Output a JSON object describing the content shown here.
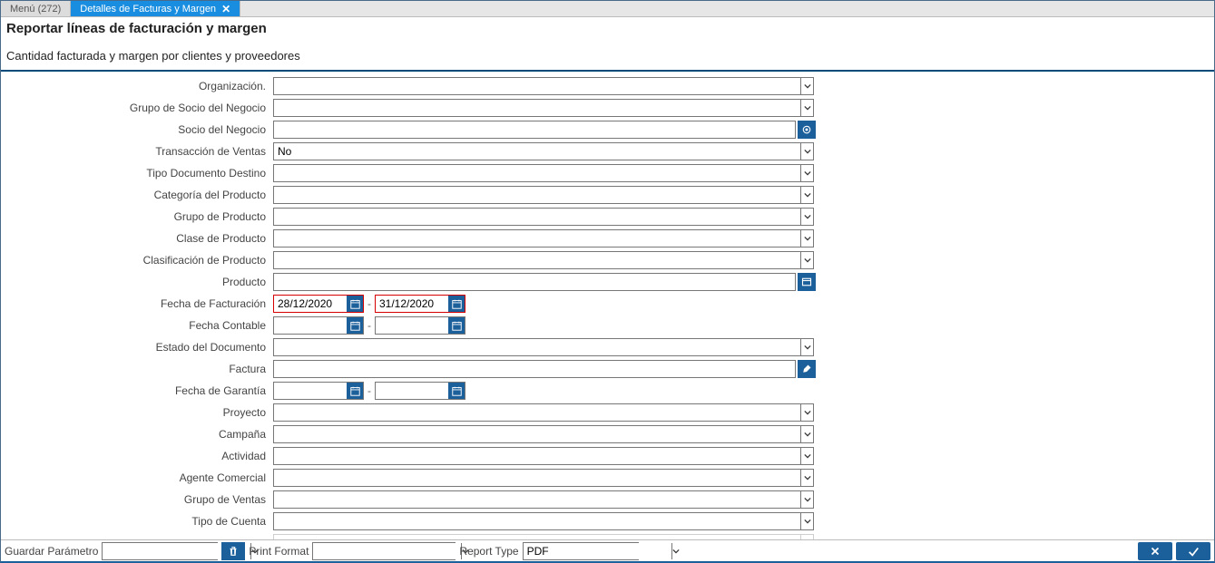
{
  "tabs": {
    "menu": "Menú (272)",
    "active": "Detalles de Facturas y Margen"
  },
  "header": {
    "title": "Reportar líneas de facturación y margen",
    "subtitle": "Cantidad facturada y margen por clientes y proveedores"
  },
  "labels": {
    "organizacion": "Organización.",
    "grupo_socio": "Grupo de Socio del Negocio",
    "socio": "Socio del Negocio",
    "txn_ventas": "Transacción de Ventas",
    "tipo_doc_destino": "Tipo Documento Destino",
    "cat_producto": "Categoría del Producto",
    "grupo_producto": "Grupo de Producto",
    "clase_producto": "Clase de Producto",
    "clasif_producto": "Clasificación de Producto",
    "producto": "Producto",
    "fecha_fact": "Fecha de Facturación",
    "fecha_cont": "Fecha Contable",
    "estado_doc": "Estado del Documento",
    "factura": "Factura",
    "fecha_garantia": "Fecha de Garantía",
    "proyecto": "Proyecto",
    "campana": "Campaña",
    "actividad": "Actividad",
    "agente": "Agente Comercial",
    "grupo_ventas": "Grupo de Ventas",
    "tipo_cuenta": "Tipo de Cuenta"
  },
  "values": {
    "txn_ventas": "No",
    "fecha_fact_from": "28/12/2020",
    "fecha_fact_to": "31/12/2020"
  },
  "footer": {
    "guardar": "Guardar Parámetro",
    "print_format": "Print Format",
    "report_type": "Report Type",
    "report_type_value": "PDF"
  }
}
